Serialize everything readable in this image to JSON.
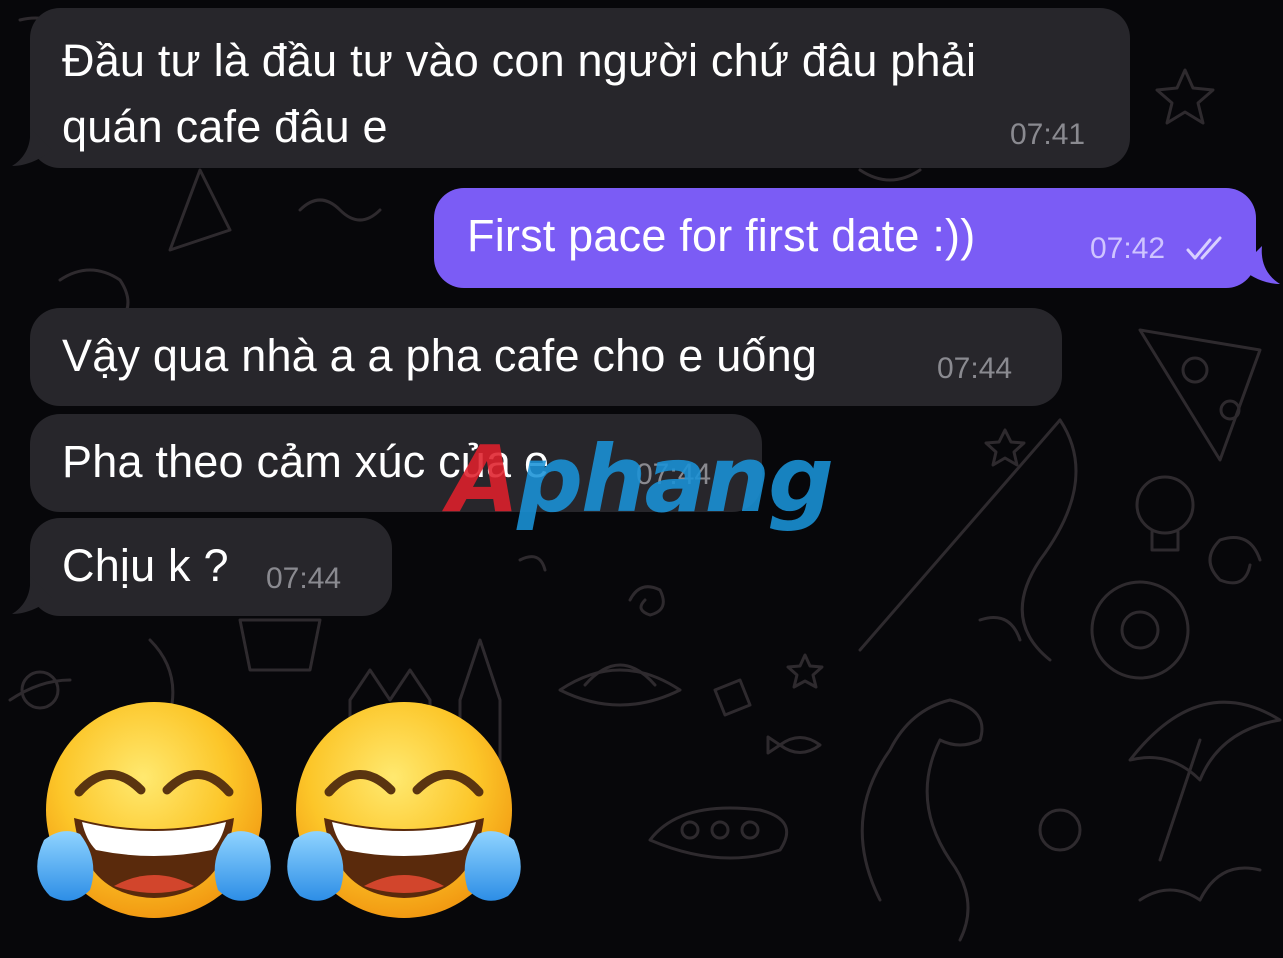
{
  "messages": [
    {
      "direction": "incoming",
      "lines": [
        "Đầu tư là đầu tư vào con người chứ đâu phải",
        "quán cafe đâu e"
      ],
      "time": "07:41"
    },
    {
      "direction": "outgoing",
      "text": "First pace for first date :))",
      "time": "07:42",
      "status_icon": "double-check-icon"
    },
    {
      "direction": "incoming",
      "text": "Vậy qua nhà a a pha cafe cho e uống",
      "time": "07:44"
    },
    {
      "direction": "incoming",
      "text": "Pha theo cảm xúc của e",
      "time": "07:44"
    },
    {
      "direction": "incoming",
      "text": "Chịu k ?",
      "time": "07:44"
    }
  ],
  "emoji_message": {
    "emojis": [
      "😂",
      "😂"
    ],
    "icon": "face-with-tears-of-joy-icon"
  },
  "watermark": {
    "first": "A",
    "rest": "phang"
  },
  "colors": {
    "background": "#07070a",
    "incoming_bubble": "#27262b",
    "outgoing_bubble": "#7b5cf5",
    "timestamp": "#8a8a90",
    "watermark_red": "#e0202c",
    "watermark_blue": "#1a93d8"
  }
}
